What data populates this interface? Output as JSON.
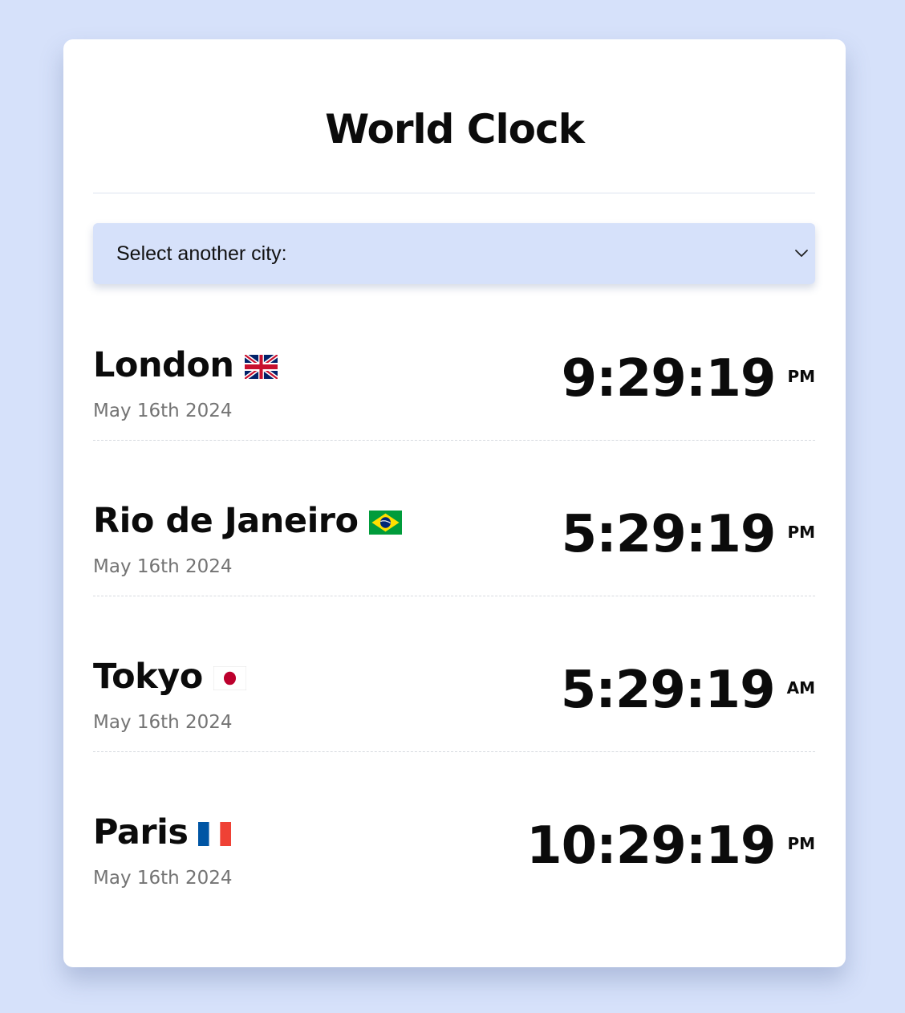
{
  "header": {
    "title": "World Clock"
  },
  "city_select": {
    "label": "Select another city:",
    "icon": "chevron-down-icon"
  },
  "cities": [
    {
      "name": "London",
      "flag": "uk-flag-icon",
      "date": "May 16th 2024",
      "time": "9:29:19",
      "period": "PM"
    },
    {
      "name": "Rio de Janeiro",
      "flag": "brazil-flag-icon",
      "date": "May 16th 2024",
      "time": "5:29:19",
      "period": "PM"
    },
    {
      "name": "Tokyo",
      "flag": "japan-flag-icon",
      "date": "May 16th 2024",
      "time": "5:29:19",
      "period": "AM"
    },
    {
      "name": "Paris",
      "flag": "france-flag-icon",
      "date": "May 16th 2024",
      "time": "10:29:19",
      "period": "PM"
    }
  ],
  "colors": {
    "page_background": "#d6e1fa",
    "card_background": "#ffffff",
    "select_background": "#d6e1fa",
    "text_primary": "#0b0b0b",
    "text_muted": "#737373"
  }
}
